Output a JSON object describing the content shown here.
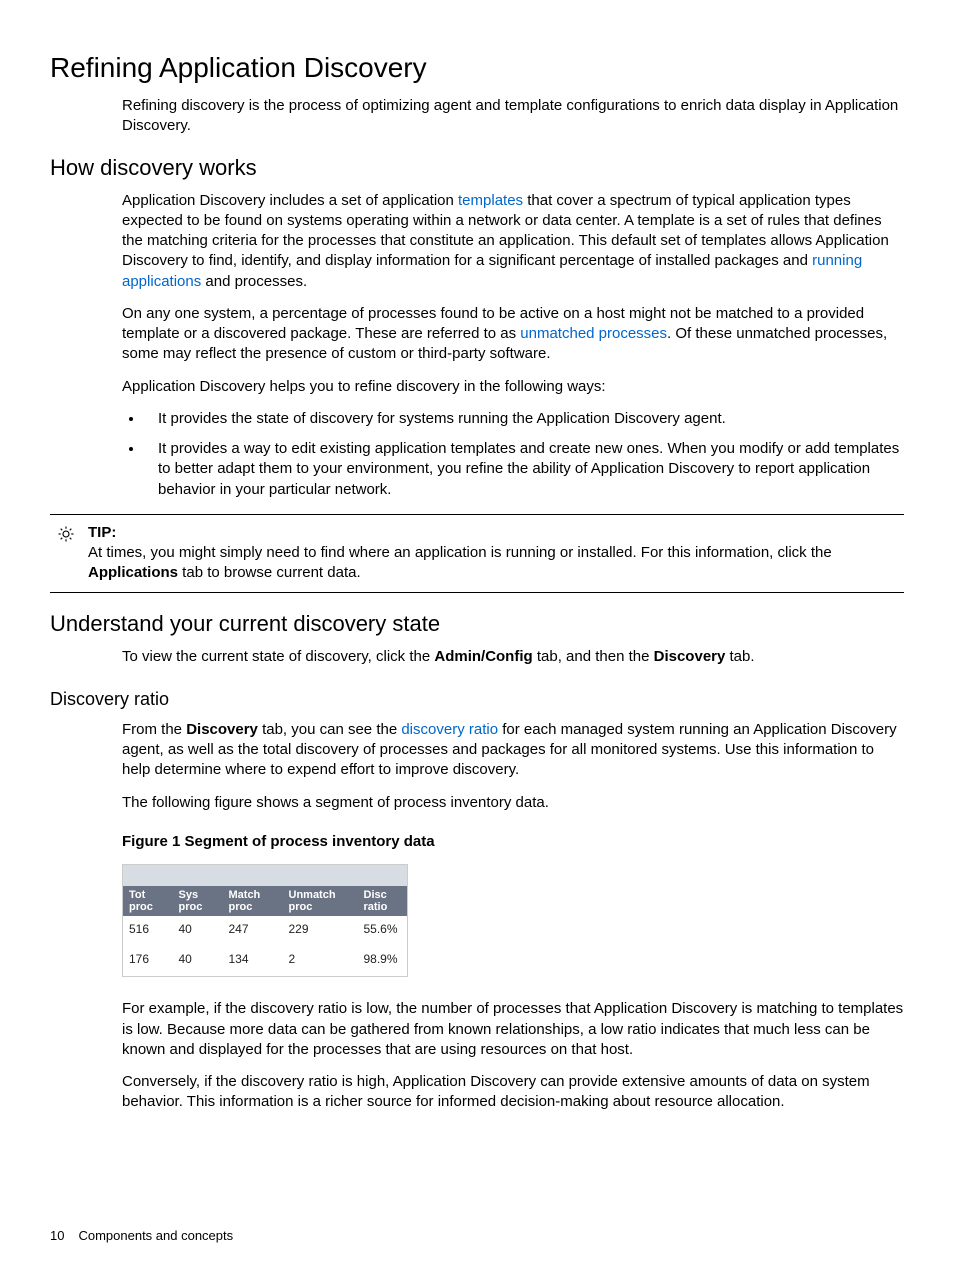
{
  "h1": "Refining Application Discovery",
  "intro_p": "Refining discovery is the process of optimizing agent and template configurations to enrich data display in Application Discovery.",
  "h2_how": "How discovery works",
  "how_p1_a": "Application Discovery includes a set of application ",
  "how_p1_link1": "templates",
  "how_p1_b": " that cover a spectrum of typical application types expected to be found on systems operating within a network or data center. A template is a set of rules that defines the matching criteria for the processes that constitute an application. This default set of templates allows Application Discovery to find, identify, and display information for a significant percentage of installed packages and ",
  "how_p1_link2": "running applications",
  "how_p1_c": " and processes.",
  "how_p2_a": "On any one system, a percentage of processes found to be active on a host might not be matched to a provided template or a discovered package. These are referred to as ",
  "how_p2_link": "unmatched processes",
  "how_p2_b": ". Of these unmatched processes, some may reflect the presence of custom or third-party software.",
  "how_p3": "Application Discovery helps you to refine discovery in the following ways:",
  "bullets": {
    "b1": "It provides  the state of discovery for systems running the Application Discovery agent.",
    "b2": "It provides a way to  edit existing application templates and create new ones. When you modify or add templates to better adapt them to your environment, you refine the ability of Application Discovery to report application behavior in your particular network."
  },
  "tip": {
    "label": "TIP:",
    "text_a": "At times, you might simply need to find where an application is running or installed. For this information, click the  ",
    "bold": "Applications",
    "text_b": " tab to browse current data."
  },
  "h2_understand": "Understand your current discovery state",
  "understand_p_a": "To view the current state of discovery, click the ",
  "understand_b1": "Admin/Config",
  "understand_p_b": " tab, and then the ",
  "understand_b2": "Discovery",
  "understand_p_c": " tab.",
  "h3_ratio": "Discovery ratio",
  "ratio_p1_a": "From the ",
  "ratio_b1": "Discovery",
  "ratio_p1_b": " tab, you can see the ",
  "ratio_link": "discovery ratio",
  "ratio_p1_c": " for each managed system running an Application Discovery agent, as well as the total discovery of processes and packages for all monitored systems. Use this information to help determine where to expend effort to improve discovery.",
  "ratio_p2": "The following figure shows a segment of process inventory data.",
  "figure_caption": "Figure 1 Segment of process inventory data",
  "table": {
    "headers": {
      "c0a": "Tot",
      "c0b": "proc",
      "c1a": "Sys",
      "c1b": "proc",
      "c2a": "Match",
      "c2b": "proc",
      "c3a": "Unmatch",
      "c3b": "proc",
      "c4a": "Disc",
      "c4b": "ratio"
    },
    "rows": [
      {
        "c0": "516",
        "c1": "40",
        "c2": "247",
        "c3": "229",
        "c4": "55.6%"
      },
      {
        "c0": "176",
        "c1": "40",
        "c2": "134",
        "c3": "2",
        "c4": "98.9%"
      }
    ]
  },
  "after_p1": "For example, if the discovery ratio is low, the number of processes that Application Discovery is matching to templates is low. Because more data can be gathered from known relationships, a low ratio indicates that much less can be known and displayed for the processes that are using resources on that host.",
  "after_p2": "Conversely, if the discovery ratio is high, Application Discovery can provide extensive amounts of data on system behavior. This information is a richer source for informed decision-making about resource allocation.",
  "footer": {
    "page": "10",
    "section": "Components and concepts"
  }
}
